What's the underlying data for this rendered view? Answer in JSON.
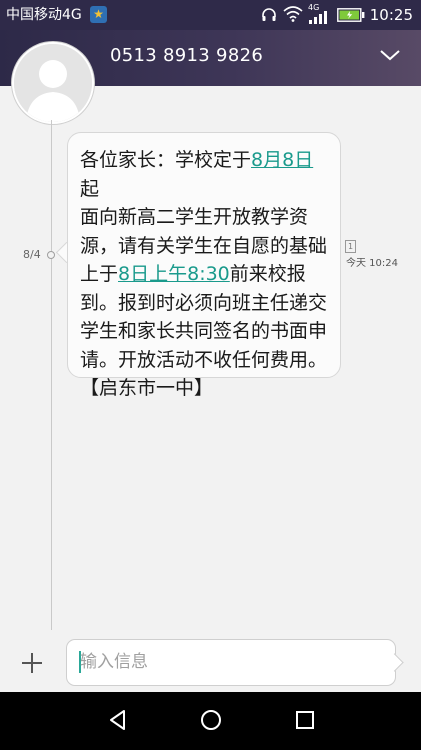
{
  "status_bar": {
    "carrier": "中国移动4G",
    "network_badge": "4G",
    "time": "10:25",
    "icons": [
      "star-badge-icon",
      "headphones-icon",
      "wifi-icon",
      "signal-icon",
      "battery-charging-icon"
    ]
  },
  "header": {
    "contact_number": "0513 8913 9826",
    "expand_icon": "chevron-down-icon"
  },
  "conversation": {
    "date_label": "8/4",
    "sim_label": "1",
    "sent_time": "今天 10:24",
    "message": {
      "lines": [
        {
          "parts": [
            {
              "t": "各位家长：学校定于"
            },
            {
              "t": "8月8日",
              "link": true
            },
            {
              "t": "起"
            }
          ]
        },
        {
          "parts": [
            {
              "t": "面向新高二学生开放教学资"
            }
          ]
        },
        {
          "parts": [
            {
              "t": "源，请有关学生在自愿的基础"
            }
          ]
        },
        {
          "parts": [
            {
              "t": "上于"
            },
            {
              "t": "8日上午8:30",
              "link": true
            },
            {
              "t": "前来校报"
            }
          ]
        },
        {
          "parts": [
            {
              "t": "到。报到时必须向班主任递交"
            }
          ]
        },
        {
          "parts": [
            {
              "t": "学生和家长共同签名的书面申"
            }
          ]
        },
        {
          "parts": [
            {
              "t": "请。开放活动不收任何费用。"
            }
          ]
        },
        {
          "parts": [
            {
              "t": "【启东市一中】"
            }
          ]
        }
      ]
    }
  },
  "compose": {
    "placeholder": "输入信息",
    "add_icon": "plus-icon"
  },
  "nav_bar": {
    "buttons": [
      "back-icon",
      "home-icon",
      "recents-icon"
    ]
  },
  "colors": {
    "header_bg": "#2d2948",
    "link": "#1a9a8c",
    "background": "#f2f2f2"
  }
}
